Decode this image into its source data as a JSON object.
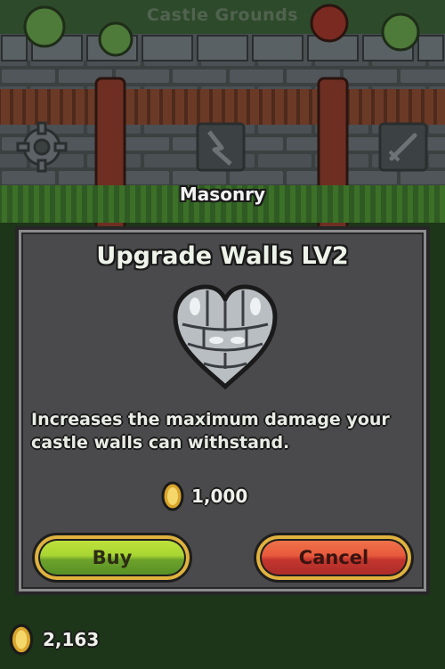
{
  "header": {
    "title": "Castle Grounds"
  },
  "section": {
    "label": "Masonry"
  },
  "dialog": {
    "title": "Upgrade Walls LV2",
    "item_icon": "stone-heart-icon",
    "description": "Increases the maximum damage your castle walls can withstand.",
    "price": "1,000",
    "buy_label": "Buy",
    "cancel_label": "Cancel"
  },
  "footer": {
    "gold": "2,163"
  },
  "icons": {
    "settings": "gear-icon",
    "lightning": "lightning-icon",
    "sword": "sword-icon",
    "coin": "coin-icon"
  },
  "colors": {
    "buy_button": "#8fc330",
    "cancel_button": "#e0503a",
    "button_rim": "#e0b23e",
    "dialog_bg": "#4a4a4c"
  }
}
